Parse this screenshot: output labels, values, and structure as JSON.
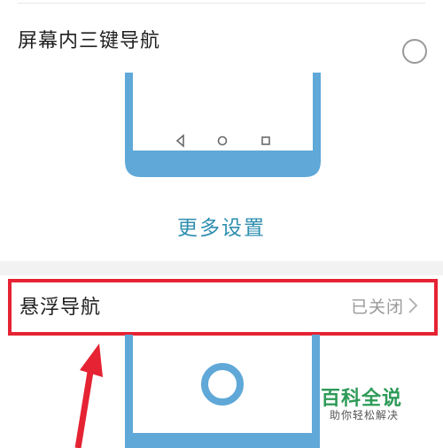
{
  "three_key_nav": {
    "label": "屏幕内三键导航",
    "selected": false
  },
  "more_settings": {
    "label": "更多设置"
  },
  "floating_nav": {
    "label": "悬浮导航",
    "status": "已关闭"
  },
  "watermark": {
    "title": "百科全说",
    "subtitle": "助你轻松解决"
  },
  "colors": {
    "phone_frame": "#5fa8d8",
    "accent_link": "#2f8fb0",
    "highlight": "#e52333",
    "watermark_green": "#2e9a58"
  }
}
